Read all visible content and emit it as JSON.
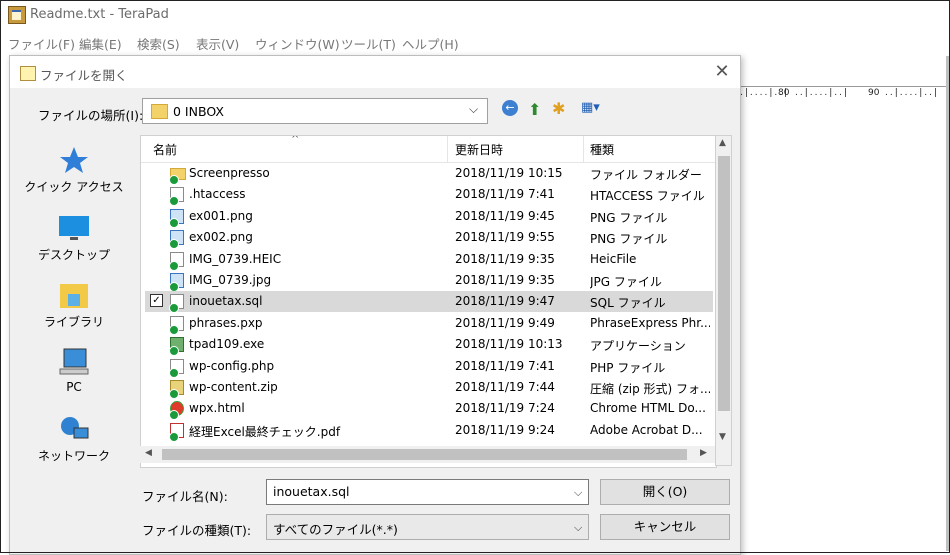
{
  "window": {
    "title": "Readme.txt - TeraPad",
    "menu": [
      "ファイル(F)",
      "編集(E)",
      "検索(S)",
      "表示(V)",
      "ウィンドウ(W)",
      "ツール(T)",
      "ヘルプ(H)"
    ],
    "ruler_labels": [
      "80",
      "90"
    ]
  },
  "dialog": {
    "title": "ファイルを開く",
    "look_in_label": "ファイルの場所(I):",
    "look_in_value": "0 INBOX",
    "places": [
      {
        "label": "クイック アクセス",
        "icon": "star-icon"
      },
      {
        "label": "デスクトップ",
        "icon": "desktop-icon"
      },
      {
        "label": "ライブラリ",
        "icon": "library-icon"
      },
      {
        "label": "PC",
        "icon": "pc-icon"
      },
      {
        "label": "ネットワーク",
        "icon": "network-icon"
      }
    ],
    "columns": {
      "name": "名前",
      "date": "更新日時",
      "type": "種類"
    },
    "files": [
      {
        "name": "Screenpresso",
        "date": "2018/11/19 10:15",
        "type": "ファイル フォルダー",
        "icon": "folder"
      },
      {
        "name": ".htaccess",
        "date": "2018/11/19 7:41",
        "type": "HTACCESS ファイル",
        "icon": "file"
      },
      {
        "name": "ex001.png",
        "date": "2018/11/19 9:45",
        "type": "PNG ファイル",
        "icon": "img"
      },
      {
        "name": "ex002.png",
        "date": "2018/11/19 9:55",
        "type": "PNG ファイル",
        "icon": "img"
      },
      {
        "name": "IMG_0739.HEIC",
        "date": "2018/11/19 9:35",
        "type": "HeicFile",
        "icon": "file"
      },
      {
        "name": "IMG_0739.jpg",
        "date": "2018/11/19 9:35",
        "type": "JPG ファイル",
        "icon": "img"
      },
      {
        "name": "inouetax.sql",
        "date": "2018/11/19 9:47",
        "type": "SQL ファイル",
        "icon": "file",
        "selected": true
      },
      {
        "name": "phrases.pxp",
        "date": "2018/11/19 9:49",
        "type": "PhraseExpress Phr...",
        "icon": "file"
      },
      {
        "name": "tpad109.exe",
        "date": "2018/11/19 10:13",
        "type": "アプリケーション",
        "icon": "exe"
      },
      {
        "name": "wp-config.php",
        "date": "2018/11/19 7:41",
        "type": "PHP ファイル",
        "icon": "file"
      },
      {
        "name": "wp-content.zip",
        "date": "2018/11/19 7:44",
        "type": "圧縮 (zip 形式) フォ...",
        "icon": "zip"
      },
      {
        "name": "wpx.html",
        "date": "2018/11/19 7:24",
        "type": "Chrome HTML Do...",
        "icon": "html"
      },
      {
        "name": "経理Excel最終チェック.pdf",
        "date": "2018/11/19 9:24",
        "type": "Adobe Acrobat D...",
        "icon": "pdf"
      }
    ],
    "filename_label": "ファイル名(N):",
    "filename_value": "inouetax.sql",
    "filetype_label": "ファイルの種類(T):",
    "filetype_value": "すべてのファイル(*.*)",
    "open_button": "開く(O)",
    "cancel_button": "キャンセル"
  }
}
